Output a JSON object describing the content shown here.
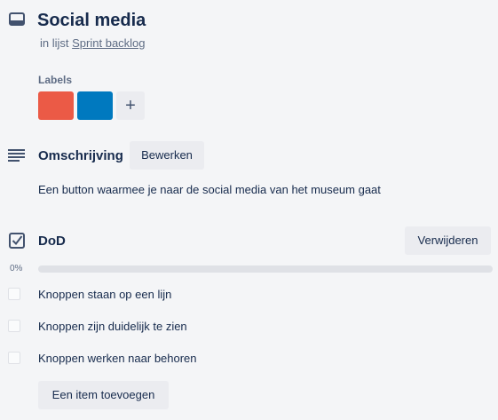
{
  "card": {
    "title": "Social media",
    "in_list_prefix": "in lijst",
    "list_name": "Sprint backlog"
  },
  "labels": {
    "heading": "Labels",
    "chips": [
      {
        "color": "#eb5a46"
      },
      {
        "color": "#0079bf"
      }
    ],
    "add_symbol": "+"
  },
  "description": {
    "heading": "Omschrijving",
    "edit_label": "Bewerken",
    "text": "Een button waarmee je naar de social media van het museum gaat"
  },
  "checklist": {
    "title": "DoD",
    "delete_label": "Verwijderen",
    "progress_text": "0%",
    "progress_fraction": 0,
    "items": [
      {
        "text": "Knoppen staan op een lijn",
        "checked": false
      },
      {
        "text": "Knoppen zijn duidelijk te zien",
        "checked": false
      },
      {
        "text": "Knoppen werken naar behoren",
        "checked": false
      }
    ],
    "add_item_label": "Een item toevoegen"
  },
  "icons": {
    "card": "card-icon",
    "description": "description-lines-icon",
    "checklist": "checkbox-checked-icon"
  }
}
